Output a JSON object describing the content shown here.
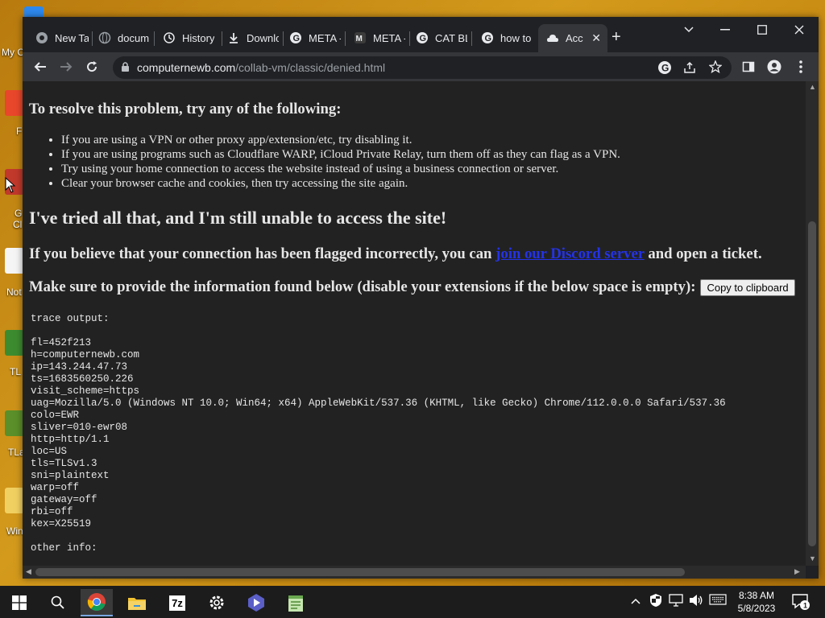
{
  "desktop": {
    "icon_labels": [
      "My C",
      "F",
      "G",
      "Cl",
      "Not",
      "TL",
      "TLa",
      "Win"
    ]
  },
  "browser": {
    "tabs": [
      {
        "label": "New Ta",
        "icon": "chrome-icon"
      },
      {
        "label": "docum",
        "icon": "globe-icon"
      },
      {
        "label": "History",
        "icon": "history-icon"
      },
      {
        "label": "Downlo",
        "icon": "download-icon"
      },
      {
        "label": "META -",
        "icon": "google-icon"
      },
      {
        "label": "META -",
        "icon": "meta-icon"
      },
      {
        "label": "CAT BL",
        "icon": "google-icon"
      },
      {
        "label": "how to",
        "icon": "google-icon"
      },
      {
        "label": "Acc",
        "icon": "cloud-icon",
        "active": true
      }
    ],
    "url_host": "computernewb.com",
    "url_path": "/collab-vm/classic/denied.html"
  },
  "page": {
    "resolve_heading": "To resolve this problem, try any of the following:",
    "tips": [
      "If you are using a VPN or other proxy app/extension/etc, try disabling it.",
      "If you are using programs such as Cloudflare WARP, iCloud Private Relay, turn them off as they can flag as a VPN.",
      "Try using your home connection to access the website instead of using a business connection or server.",
      "Clear your browser cache and cookies, then try accessing the site again."
    ],
    "still_heading": "I've tried all that, and I'm still unable to access the site!",
    "flagged_prefix": "If you believe that your connection has been flagged incorrectly, you can ",
    "discord_link": "join our Discord server",
    "flagged_suffix": " and open a ticket.",
    "provide_heading": "Make sure to provide the information found below (disable your extensions if the below space is empty):",
    "copy_button": "Copy to clipboard",
    "trace_title": "trace output:",
    "trace_lines": [
      "fl=452f213",
      "h=computernewb.com",
      "ip=143.244.47.73",
      "ts=1683560250.226",
      "visit_scheme=https",
      "uag=Mozilla/5.0 (Windows NT 10.0; Win64; x64) AppleWebKit/537.36 (KHTML, like Gecko) Chrome/112.0.0.0 Safari/537.36",
      "colo=EWR",
      "sliver=010-ewr08",
      "http=http/1.1",
      "loc=US",
      "tls=TLSv1.3",
      "sni=plaintext",
      "warp=off",
      "gateway=off",
      "rbi=off",
      "kex=X25519"
    ],
    "other_info": "other info:"
  },
  "taskbar": {
    "time": "8:38 AM",
    "date": "5/8/2023",
    "notification_count": "1",
    "sevenzip_label": "7z"
  },
  "colors": {
    "link": "#2433e8",
    "page_bg": "#222222",
    "chrome_dark": "#202124"
  }
}
